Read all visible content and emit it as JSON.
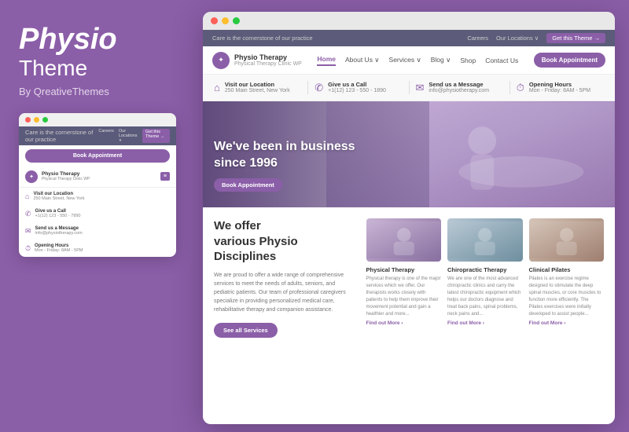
{
  "brand": {
    "physio": "Physio",
    "theme": "Theme",
    "by": "By QreativeThemes"
  },
  "mini_browser": {
    "topbar": {
      "tagline": "Care is the cornerstone of our practice",
      "links": [
        "Careers",
        "Our Locations ∨",
        "Get this Theme →"
      ]
    },
    "book_btn": "Book Appointment",
    "brand_name": "Physio Therapy",
    "brand_sub": "Physical Therapy Clinic WP",
    "info_items": [
      {
        "label": "Visit our Location",
        "value": "250 Main Street, New York"
      },
      {
        "label": "Give us a Call",
        "value": "+1(12) 123 - 550 - 7890"
      },
      {
        "label": "Send us a Message",
        "value": "info@physiotherapy.com"
      },
      {
        "label": "Opening Hours",
        "value": "Mon - Friday: 8AM - 5PM"
      }
    ]
  },
  "main_browser": {
    "utility_bar": {
      "tagline": "Care is the cornerstone of our practice",
      "links": [
        "Careers",
        "Our Locations ∨",
        "Get this Theme →"
      ]
    },
    "nav": {
      "brand_name": "Physio Therapy",
      "brand_sub": "Physical Therapy Clinic WP",
      "links": [
        "Home",
        "About Us ∨",
        "Services ∨",
        "Blog ∨",
        "Shop",
        "Contact Us"
      ],
      "book_btn": "Book Appointment"
    },
    "info_bar": [
      {
        "label": "Visit our Location",
        "value": "250 Main Street, New York"
      },
      {
        "label": "Give us a Call",
        "value": "+1(12) 123 - 550 - 1890"
      },
      {
        "label": "Send us a Message",
        "value": "info@physiotherapy.com"
      },
      {
        "label": "Opening Hours",
        "value": "Mon - Friday: 8AM - 5PM"
      }
    ],
    "hero": {
      "title_line1": "We've been in business",
      "title_line2": "since 1996",
      "book_btn": "Book Appointment"
    },
    "services": {
      "title_line1": "We offer",
      "title_line2": "various Physio",
      "title_line3": "Disciplines",
      "description": "We are proud to offer a wide range of comprehensive services to meet the needs of adults, seniors, and pediatric patients. Our team of professional caregivers specialize in providing personalized medical care, rehabilitative therapy and companion assistance.",
      "see_btn": "See all Services",
      "cards": [
        {
          "title": "Physical Therapy",
          "description": "Physical therapy is one of the major services which we offer. Our therapists works closely with patients to help them improve their movement potential and gain a healthier and more...",
          "link": "Find out More ›"
        },
        {
          "title": "Chiropractic Therapy",
          "description": "We are one of the most advanced chiropractic clinics and carry the latest chiropractic equipment which helps our doctors diagnose and treat back pains, spinal problems, neck pains and...",
          "link": "Find out More ›"
        },
        {
          "title": "Clinical Pilates",
          "description": "Pilates is an exercise regime designed to stimulate the deep spinal muscles, or core muscles to function more efficiently. The Pilates exercises were initially developed to assist people...",
          "link": "Find out More ›"
        }
      ]
    }
  },
  "colors": {
    "accent": "#8b5ea8",
    "dark_bar": "#5c5c7a"
  }
}
